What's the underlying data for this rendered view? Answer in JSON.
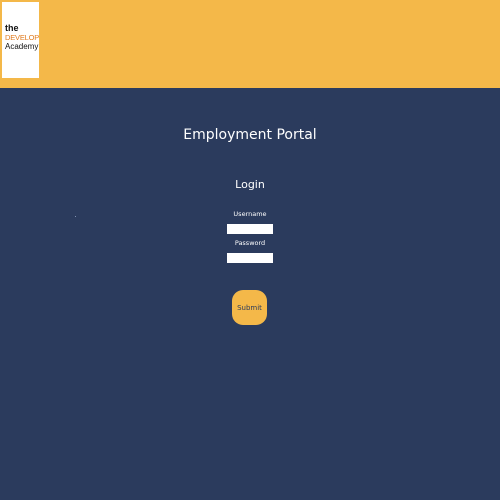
{
  "header": {
    "logo": {
      "line1": "the",
      "line2": "DEVELOPER",
      "line3": "Academy"
    }
  },
  "main": {
    "title": "Employment Portal",
    "login_heading": "Login",
    "username_label": "Username",
    "username_value": "",
    "password_label": "Password",
    "password_value": "",
    "submit_label": "Submit"
  },
  "colors": {
    "header_bg": "#f4b849",
    "page_bg": "#2b3b5d",
    "accent": "#e07b1f"
  }
}
